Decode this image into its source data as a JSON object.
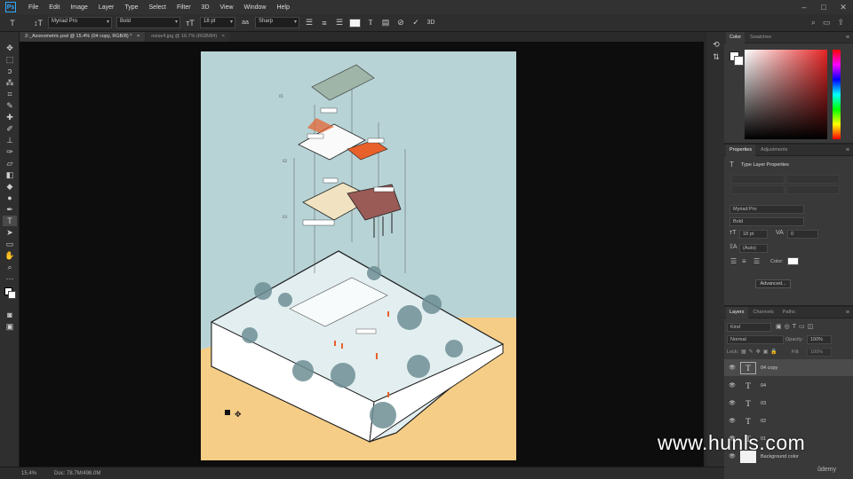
{
  "app": {
    "logo": "Ps"
  },
  "menu": [
    "File",
    "Edit",
    "Image",
    "Layer",
    "Type",
    "Select",
    "Filter",
    "3D",
    "View",
    "Window",
    "Help"
  ],
  "window_controls": [
    "–",
    "□",
    "✕"
  ],
  "options": {
    "font_family": "Myriad Pro",
    "font_style": "Bold",
    "font_size": "18 pt",
    "antialias": "Sharp",
    "right_label": "3D"
  },
  "tabs": [
    {
      "label": "2-_Axonometric.psd @ 15.4% (04 copy, RGB/8) *",
      "close": "×"
    },
    {
      "label": "noise4.jpg @ 16.7% (RGB/8#)",
      "close": "×"
    }
  ],
  "status": {
    "zoom": "15.4%",
    "doc": "Doc: 78.7M/498.0M"
  },
  "color_panel": {
    "tabs": [
      "Color",
      "Swatches"
    ],
    "hue_accent": "#e62525"
  },
  "properties_panel": {
    "tabs": [
      "Properties",
      "Adjustments"
    ],
    "title": "Type Layer Properties",
    "font_family": "Myriad Pro",
    "font_style": "Bold",
    "font_size": "18 pt",
    "tracking": "0",
    "leading": "(Auto)",
    "color_label": "Color:",
    "advanced_button": "Advanced..."
  },
  "layers_panel": {
    "tabs": [
      "Layers",
      "Channels",
      "Paths"
    ],
    "search_placeholder": "Kind",
    "blend_mode": "Normal",
    "opacity_label": "Opacity:",
    "opacity": "100%",
    "lock_label": "Lock:",
    "fill_label": "Fill:",
    "fill": "100%",
    "layers": [
      {
        "name": "04 copy",
        "type": "T",
        "selected": true
      },
      {
        "name": "04",
        "type": "T",
        "selected": false
      },
      {
        "name": "03",
        "type": "T",
        "selected": false
      },
      {
        "name": "02",
        "type": "T",
        "selected": false
      },
      {
        "name": "01",
        "type": "T",
        "selected": false
      },
      {
        "name": "Background color",
        "type": "fill",
        "selected": false
      }
    ]
  },
  "artwork": {
    "level_labels": [
      "01",
      "02",
      "03"
    ],
    "background_sky": "#b8d3d6",
    "ground_color": "#f5cd86",
    "accent_orange": "#e8602a"
  },
  "watermark": "www.hunls.com",
  "udemy_badge": "ûdemy"
}
